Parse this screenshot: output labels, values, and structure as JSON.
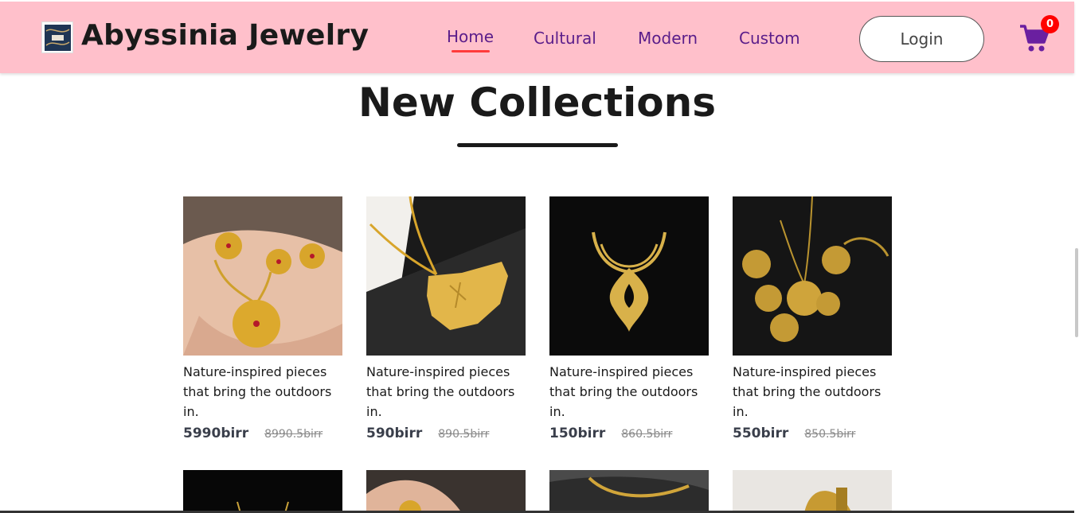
{
  "header": {
    "brand": "Abyssinia Jewelry",
    "logo_icon": "brand-logo-icon",
    "nav": [
      {
        "label": "Home",
        "active": true
      },
      {
        "label": "Cultural"
      },
      {
        "label": "Modern"
      },
      {
        "label": "Custom"
      }
    ],
    "login_label": "Login",
    "cart_icon": "shopping-cart-icon",
    "cart_count": "0",
    "colors": {
      "bar": "#ffc0cb",
      "nav_text": "#5a1d8a",
      "active_underline": "#ff3b3b",
      "cart": "#6a1fa0",
      "badge": "#ff0000"
    }
  },
  "main": {
    "title": "New Collections",
    "products": [
      {
        "image": "gold-pendant-earrings-photo",
        "description": "Nature-inspired pieces that bring the outdoors in.",
        "price": "5990birr",
        "old_price": "8990.5birr"
      },
      {
        "image": "gold-map-pendant-photo",
        "description": "Nature-inspired pieces that bring the outdoors in.",
        "price": "590birr",
        "old_price": "890.5birr"
      },
      {
        "image": "gold-collar-necklace-photo",
        "description": "Nature-inspired pieces that bring the outdoors in.",
        "price": "150birr",
        "old_price": "860.5birr"
      },
      {
        "image": "gold-filigree-set-photo",
        "description": "Nature-inspired pieces that bring the outdoors in.",
        "price": "550birr",
        "old_price": "850.5birr"
      }
    ],
    "second_row_images": [
      "dark-necklace-photo",
      "hand-pendant-photo",
      "chain-necklace-photo",
      "gold-ring-photo"
    ]
  }
}
